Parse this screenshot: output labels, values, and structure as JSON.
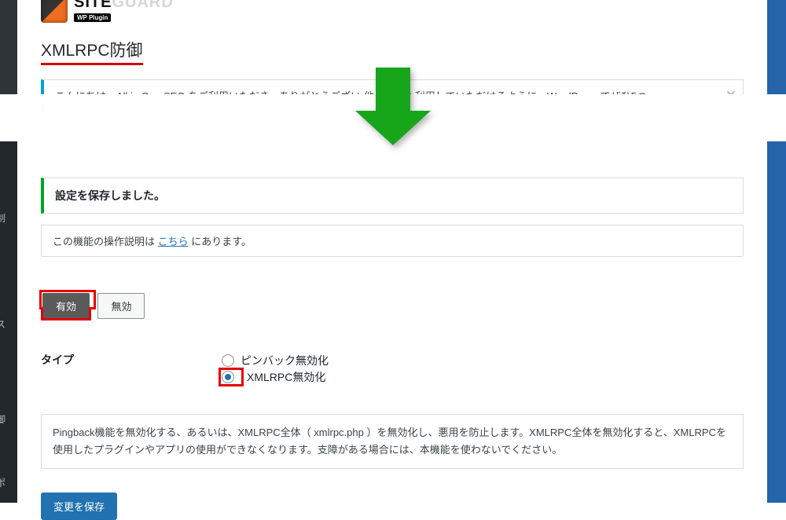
{
  "plugin": {
    "name_main": "SITEGUARD",
    "name_sub": "WP Plugin"
  },
  "page_title": "XMLRPC防御",
  "aioseo_notice": "こんにちは。All in One SEO をご利用いただき、ありがとうござい            他の方にも利用していただけるように、WordPress でぜひ5つ",
  "saved_msg": "設定を保存しました。",
  "explain_prefix": "この機能の操作説明は ",
  "explain_link": "こちら",
  "explain_suffix": " にあります。",
  "toggle": {
    "on": "有効",
    "off": "無効"
  },
  "type_section": {
    "label": "タイプ",
    "opt_pingback": "ピンバック無効化",
    "opt_xmlrpc": "XMLRPC無効化"
  },
  "description": "Pingback機能を無効化する、あるいは、XMLRPC全体（ xmlrpc.php ）を無効化し、悪用を防止します。XMLRPC全体を無効化すると、XMLRPCを使用したプラグインやアプリの使用ができなくなります。支障がある場合には、本機能を使わないでください。",
  "save_button": "変更を保存",
  "sidebar_fragments": {
    "a": "制",
    "b": "ス",
    "c": "御",
    "d": "ポ"
  }
}
